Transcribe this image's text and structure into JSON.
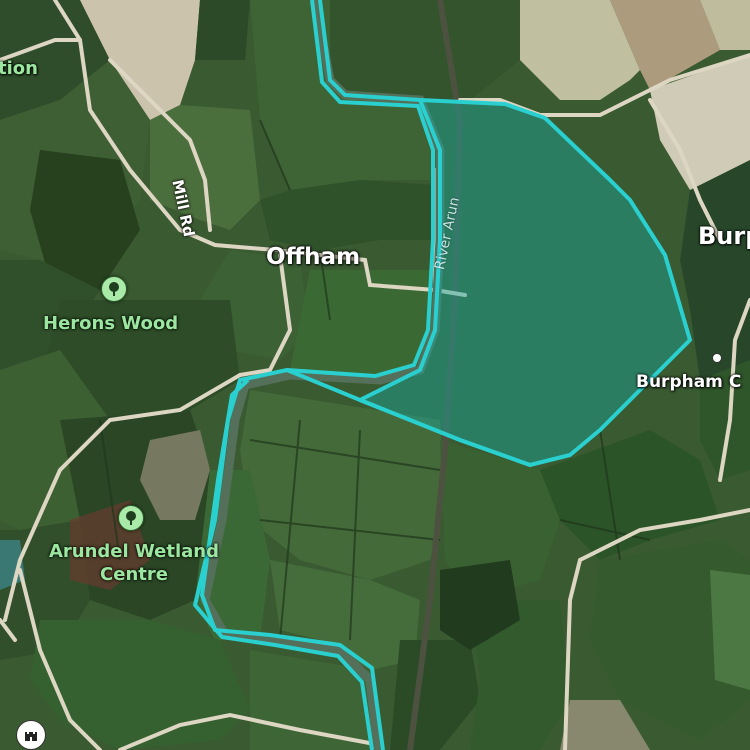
{
  "map": {
    "type": "satellite",
    "colors": {
      "boundary": "#2ad0cf",
      "boundary_fill": "#1aa8a0",
      "road": "#dcd6c4",
      "green_label": "#9be7a0"
    }
  },
  "places": {
    "offham": "Offham",
    "burpham_partial": "Burp",
    "burpham_c": "Burpham C",
    "partial_left": "tion"
  },
  "roads": {
    "mill_rd": "Mill Rd"
  },
  "water": {
    "river_arun": "River Arun"
  },
  "pois": {
    "herons_wood": "Herons Wood",
    "arundel_wetland_line1": "Arundel Wetland",
    "arundel_wetland_line2": "Centre"
  },
  "icons": [
    "tree-icon",
    "tree-icon",
    "castle-icon",
    "location-dot"
  ]
}
